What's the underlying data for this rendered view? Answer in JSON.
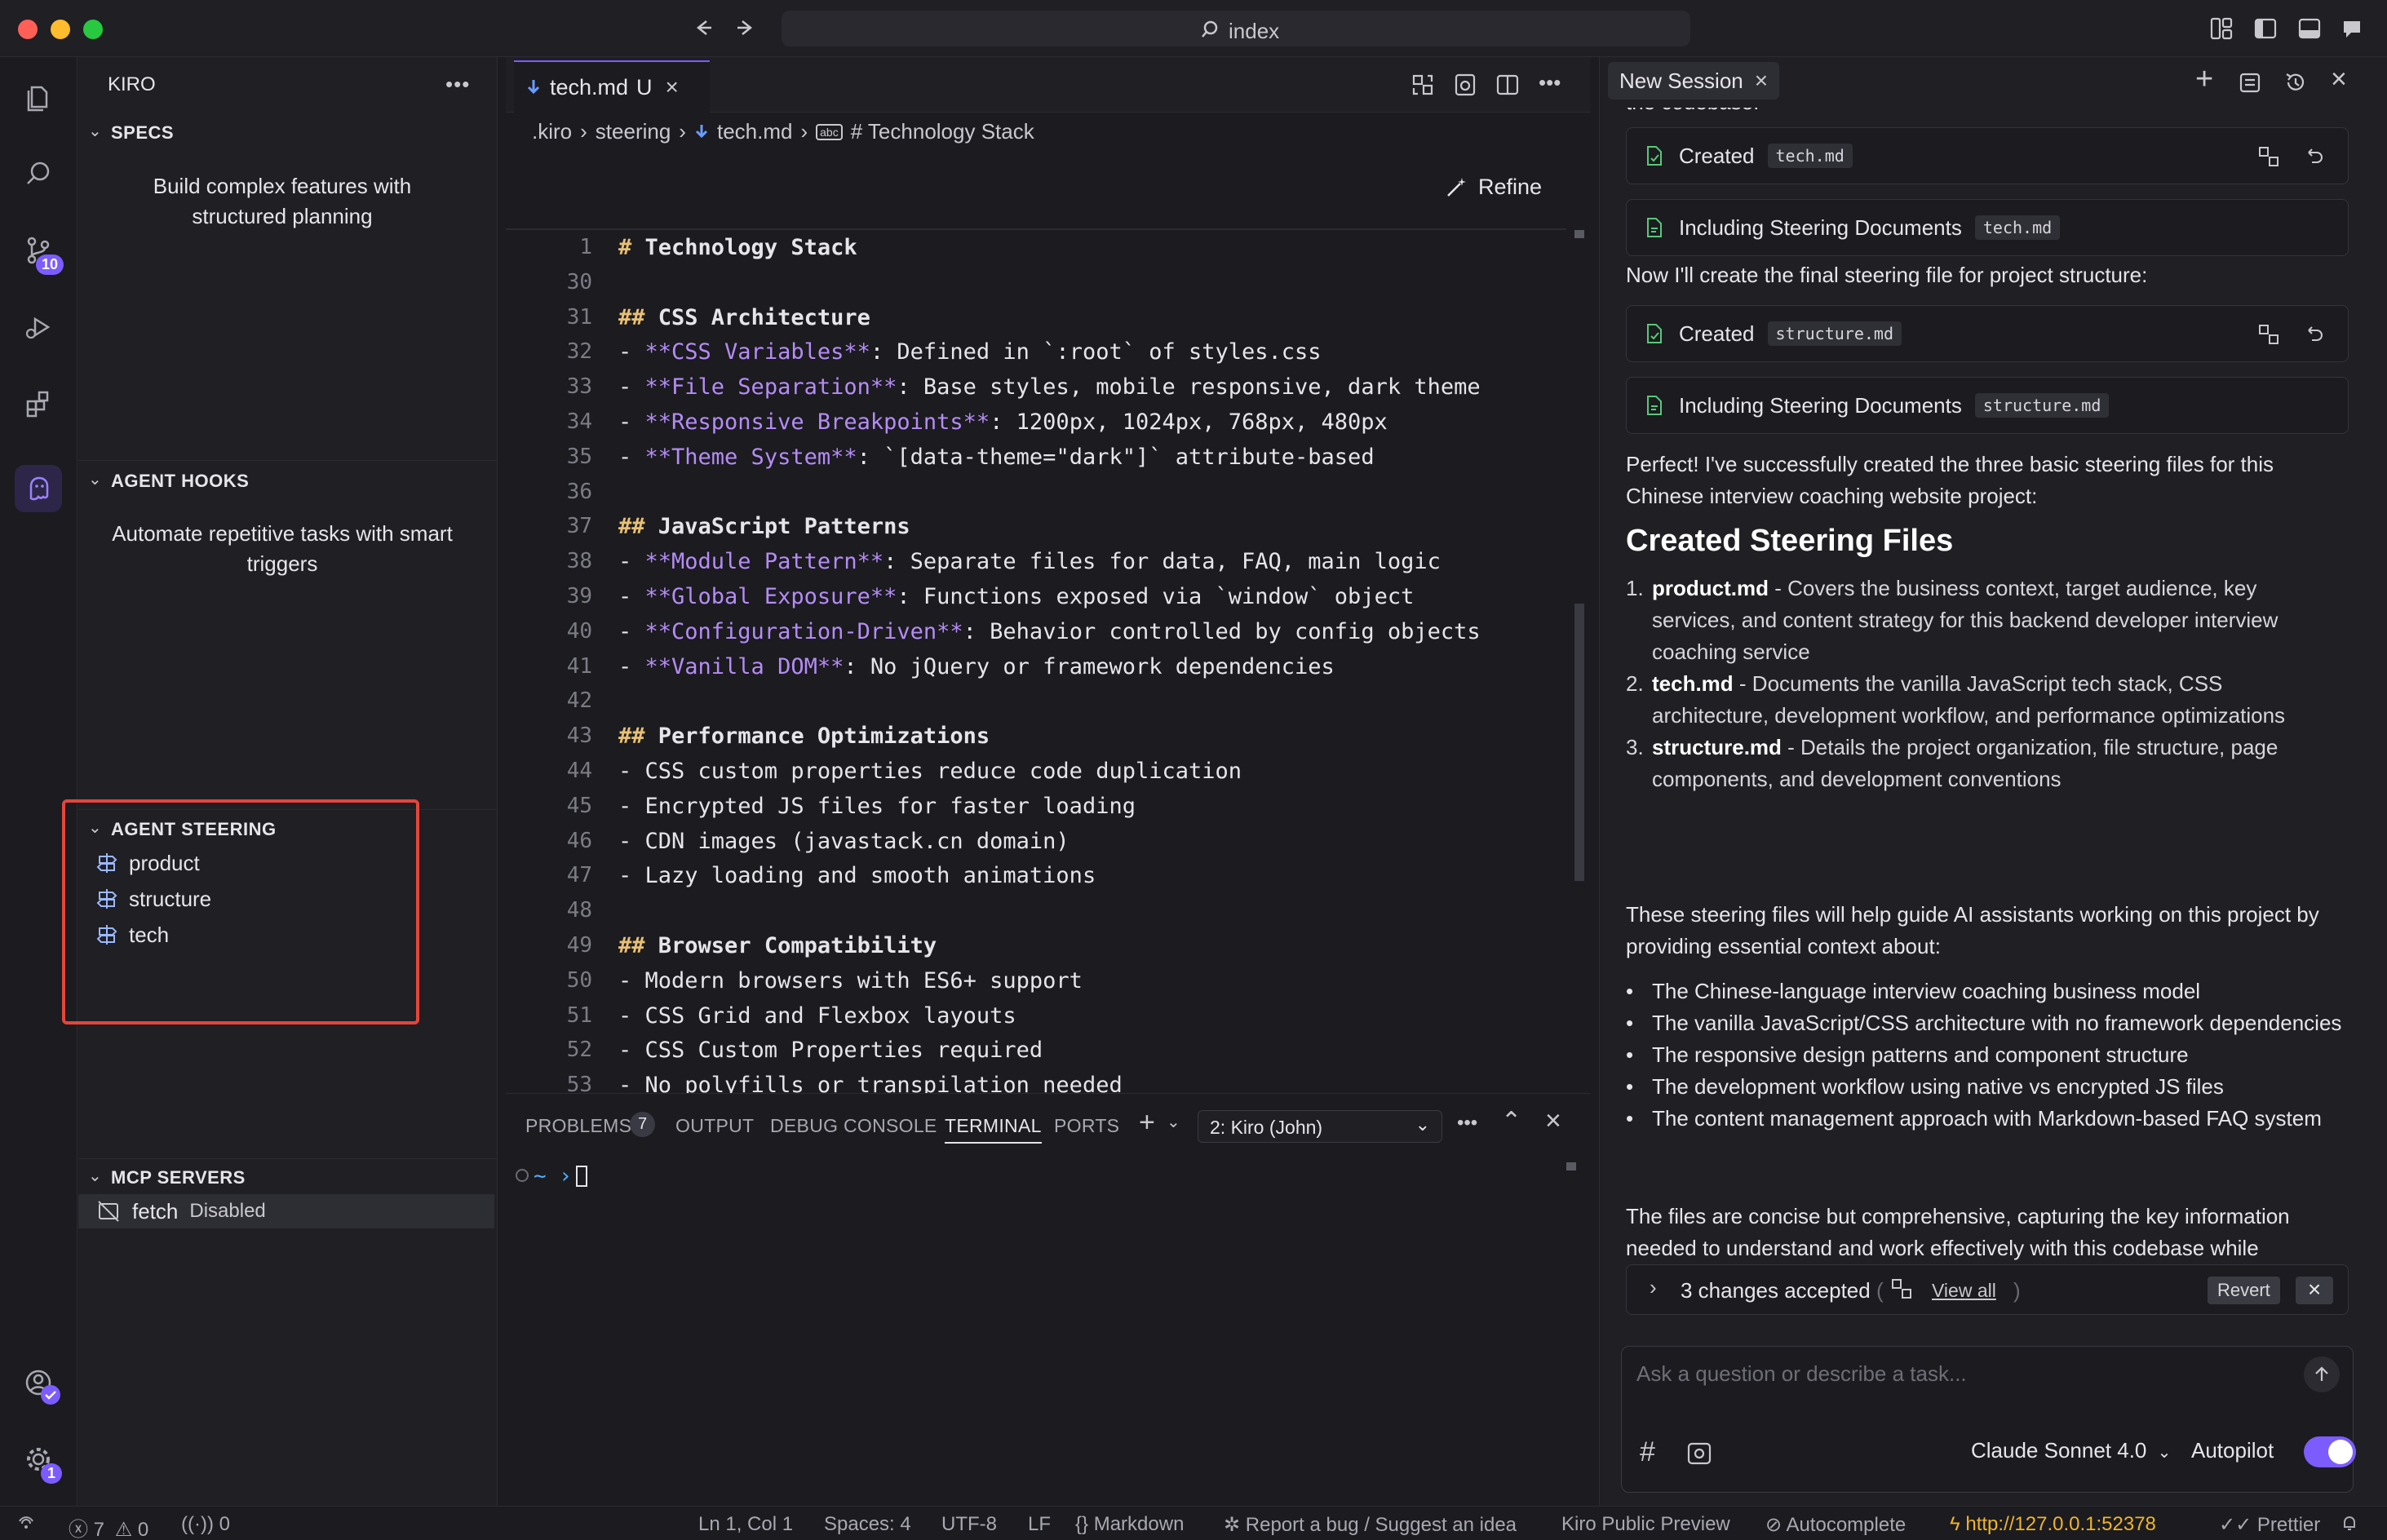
{
  "titlebar": {
    "search_label": "index"
  },
  "activity": {
    "scm_badge": "10",
    "settings_badge": "1"
  },
  "sidebar": {
    "header": "KIRO",
    "specs": {
      "title": "SPECS",
      "desc": "Build complex features with structured planning"
    },
    "hooks": {
      "title": "AGENT HOOKS",
      "desc": "Automate repetitive tasks with smart triggers"
    },
    "steering": {
      "title": "AGENT STEERING",
      "items": [
        "product",
        "structure",
        "tech"
      ]
    },
    "mcp": {
      "title": "MCP SERVERS",
      "server_name": "fetch",
      "server_status": "Disabled"
    }
  },
  "editor": {
    "tab_label": "tech.md",
    "tab_status": "U",
    "breadcrumb": [
      ".kiro",
      "steering",
      "tech.md",
      "# Technology Stack"
    ],
    "refine_label": "Refine",
    "lines": [
      {
        "n": "1",
        "segs": [
          {
            "t": "# ",
            "c": "hd"
          },
          {
            "t": "Technology Stack",
            "c": "hdt"
          }
        ]
      },
      {
        "n": "30",
        "segs": []
      },
      {
        "n": "31",
        "segs": [
          {
            "t": "## ",
            "c": "hd"
          },
          {
            "t": "CSS Architecture",
            "c": "hdt"
          }
        ]
      },
      {
        "n": "32",
        "segs": [
          {
            "t": "- ",
            "c": ""
          },
          {
            "t": "**CSS Variables**",
            "c": "bd"
          },
          {
            "t": ": Defined in `:root` of styles.css",
            "c": ""
          }
        ]
      },
      {
        "n": "33",
        "segs": [
          {
            "t": "- ",
            "c": ""
          },
          {
            "t": "**File Separation**",
            "c": "bd"
          },
          {
            "t": ": Base styles, mobile responsive, dark theme",
            "c": ""
          }
        ]
      },
      {
        "n": "34",
        "segs": [
          {
            "t": "- ",
            "c": ""
          },
          {
            "t": "**Responsive Breakpoints**",
            "c": "bd"
          },
          {
            "t": ": 1200px, 1024px, 768px, 480px",
            "c": ""
          }
        ]
      },
      {
        "n": "35",
        "segs": [
          {
            "t": "- ",
            "c": ""
          },
          {
            "t": "**Theme System**",
            "c": "bd"
          },
          {
            "t": ": `[data-theme=\"dark\"]` attribute-based",
            "c": ""
          }
        ]
      },
      {
        "n": "36",
        "segs": []
      },
      {
        "n": "37",
        "segs": [
          {
            "t": "## ",
            "c": "hd"
          },
          {
            "t": "JavaScript Patterns",
            "c": "hdt"
          }
        ]
      },
      {
        "n": "38",
        "segs": [
          {
            "t": "- ",
            "c": ""
          },
          {
            "t": "**Module Pattern**",
            "c": "bd"
          },
          {
            "t": ": Separate files for data, FAQ, main logic",
            "c": ""
          }
        ]
      },
      {
        "n": "39",
        "segs": [
          {
            "t": "- ",
            "c": ""
          },
          {
            "t": "**Global Exposure**",
            "c": "bd"
          },
          {
            "t": ": Functions exposed via `window` object",
            "c": ""
          }
        ]
      },
      {
        "n": "40",
        "segs": [
          {
            "t": "- ",
            "c": ""
          },
          {
            "t": "**Configuration-Driven**",
            "c": "bd"
          },
          {
            "t": ": Behavior controlled by config objects",
            "c": ""
          }
        ]
      },
      {
        "n": "41",
        "segs": [
          {
            "t": "- ",
            "c": ""
          },
          {
            "t": "**Vanilla DOM**",
            "c": "bd"
          },
          {
            "t": ": No jQuery or framework dependencies",
            "c": ""
          }
        ]
      },
      {
        "n": "42",
        "segs": []
      },
      {
        "n": "43",
        "segs": [
          {
            "t": "## ",
            "c": "hd"
          },
          {
            "t": "Performance Optimizations",
            "c": "hdt"
          }
        ]
      },
      {
        "n": "44",
        "segs": [
          {
            "t": "- CSS custom properties reduce code duplication",
            "c": ""
          }
        ]
      },
      {
        "n": "45",
        "segs": [
          {
            "t": "- Encrypted JS files for faster loading",
            "c": ""
          }
        ]
      },
      {
        "n": "46",
        "segs": [
          {
            "t": "- CDN images (javastack.cn domain)",
            "c": ""
          }
        ]
      },
      {
        "n": "47",
        "segs": [
          {
            "t": "- Lazy loading and smooth animations",
            "c": ""
          }
        ]
      },
      {
        "n": "48",
        "segs": []
      },
      {
        "n": "49",
        "segs": [
          {
            "t": "## ",
            "c": "hd"
          },
          {
            "t": "Browser Compatibility",
            "c": "hdt"
          }
        ]
      },
      {
        "n": "50",
        "segs": [
          {
            "t": "- Modern browsers with ES6+ support",
            "c": ""
          }
        ]
      },
      {
        "n": "51",
        "segs": [
          {
            "t": "- CSS Grid and Flexbox layouts",
            "c": ""
          }
        ]
      },
      {
        "n": "52",
        "segs": [
          {
            "t": "- CSS Custom Properties required",
            "c": ""
          }
        ]
      },
      {
        "n": "53",
        "segs": [
          {
            "t": "- No polyfills or transpilation needed",
            "c": ""
          }
        ]
      }
    ]
  },
  "panel": {
    "tabs": [
      "PROBLEMS",
      "OUTPUT",
      "DEBUG CONSOLE",
      "TERMINAL",
      "PORTS"
    ],
    "problems_count": "7",
    "terminal_select": "2: Kiro (John)",
    "prompt": "~ ›"
  },
  "chat": {
    "tab_label": "New Session",
    "cut_text": "the codebase.",
    "cards": [
      {
        "label": "Created",
        "file": "tech.md"
      },
      {
        "label": "Including Steering Documents",
        "file": "tech.md"
      },
      {
        "label": "Created",
        "file": "structure.md"
      },
      {
        "label": "Including Steering Documents",
        "file": "structure.md"
      }
    ],
    "msg1": "Now I'll create the final steering file for project structure:",
    "msg2": "Perfect! I've successfully created the three basic steering files for this Chinese interview coaching website project:",
    "heading": "Created Steering Files",
    "files": [
      {
        "num": "1.",
        "name": "product.md",
        "desc": " - Covers the business context, target audience, key services, and content strategy for this backend developer interview coaching service"
      },
      {
        "num": "2.",
        "name": "tech.md",
        "desc": " - Documents the vanilla JavaScript tech stack, CSS architecture, development workflow, and performance optimizations"
      },
      {
        "num": "3.",
        "name": "structure.md",
        "desc": " - Details the project organization, file structure, page components, and development conventions"
      }
    ],
    "msg3": "These steering files will help guide AI assistants working on this project by providing essential context about:",
    "bullets": [
      "The Chinese-language interview coaching business model",
      "The vanilla JavaScript/CSS architecture with no framework dependencies",
      "The responsive design patterns and component structure",
      "The development workflow using native vs encrypted JS files",
      "The content management approach with Markdown-based FAQ system"
    ],
    "msg4": "The files are concise but comprehensive, capturing the key information needed to understand and work effectively with this codebase while following the project's established patterns and conventions.",
    "changes_label": "3 changes accepted",
    "view_all": "View all",
    "revert_label": "Revert",
    "input_placeholder": "Ask a question or describe a task...",
    "model_label": "Claude Sonnet 4.0",
    "autopilot_label": "Autopilot",
    "autopilot_on": true
  },
  "statusbar": {
    "errors": "7",
    "warnings": "0",
    "ports": "0",
    "position": "Ln 1, Col 1",
    "spaces": "Spaces: 4",
    "encoding": "UTF-8",
    "eol": "LF",
    "language": "Markdown",
    "report": "Report a bug / Suggest an idea",
    "preview": "Kiro Public Preview",
    "autocomplete": "Autocomplete",
    "url": "http://127.0.0.1:52378",
    "prettier": "Prettier"
  },
  "colors": {
    "accent": "#7c5cff",
    "highlight_box": "#e5453a",
    "heading": "#e8c074",
    "bold": "#b58cf5",
    "url": "#f0b429"
  }
}
